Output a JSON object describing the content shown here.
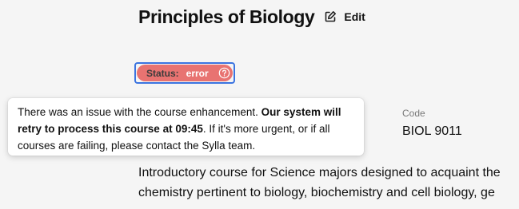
{
  "header": {
    "title": "Principles of Biology",
    "edit_label": "Edit",
    "edit_icon": "pencil-square-icon"
  },
  "status": {
    "key": "Status:",
    "value": "error",
    "value_color": "#e87371",
    "help_icon": "question-circle-icon"
  },
  "tooltip": {
    "text_start": "There was an issue with the course enhancement. ",
    "text_bold": "Our system will retry to process this course at 09:45",
    "text_end": ". If it's more urgent, or if all courses are failing, please contact the Sylla team."
  },
  "course": {
    "code_label": "Code",
    "code_value": "BIOL 9011",
    "description_line1": "Introductory course for Science majors designed to acquaint the",
    "description_line2": "chemistry pertinent to biology, biochemistry and cell biology, ge"
  },
  "colors": {
    "focus_ring": "#3b74e0",
    "background": "#f5f5f5"
  }
}
